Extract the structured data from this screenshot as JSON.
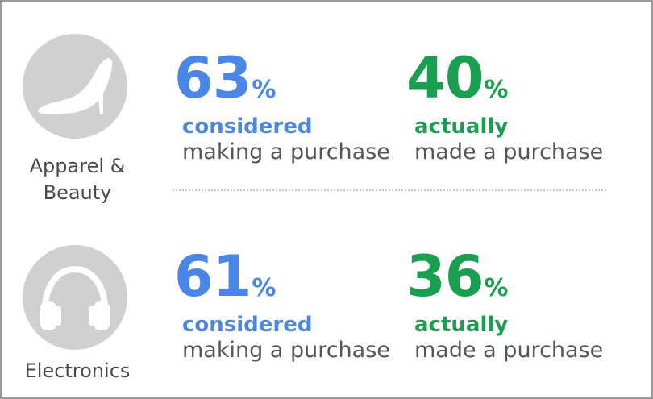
{
  "colors": {
    "blue": "#4a86e8",
    "green": "#1a9e50",
    "icon_bg": "#d0d0d0",
    "text_gray": "#555555"
  },
  "rows": [
    {
      "icon": "high-heel-shoe-icon",
      "label_line1": "Apparel &",
      "label_line2": "Beauty",
      "considered": {
        "value": "63",
        "symbol": "%",
        "keyword": "considered",
        "rest": "making a purchase"
      },
      "actual": {
        "value": "40",
        "symbol": "%",
        "keyword": "actually",
        "rest": "made a purchase"
      }
    },
    {
      "icon": "headphones-icon",
      "label_line1": "Electronics",
      "label_line2": "",
      "considered": {
        "value": "61",
        "symbol": "%",
        "keyword": "considered",
        "rest": "making a purchase"
      },
      "actual": {
        "value": "36",
        "symbol": "%",
        "keyword": "actually",
        "rest": "made a purchase"
      }
    }
  ]
}
